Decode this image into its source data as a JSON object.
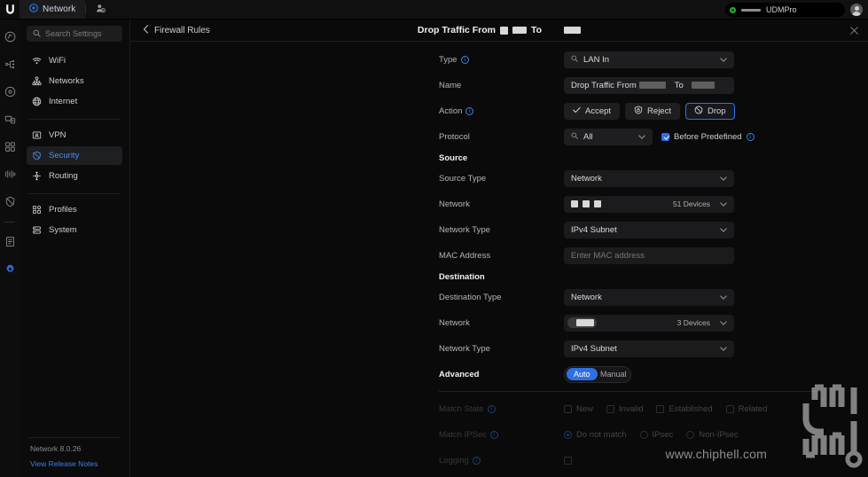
{
  "topbar": {
    "brand_icon": "ubiquiti-u-logo",
    "tabs": [
      {
        "label": "Network",
        "icon": "network-circle-icon",
        "active": true
      },
      {
        "label": "",
        "icon": "admin-users-icon",
        "active": false
      }
    ],
    "device": {
      "name": "UDMPro",
      "status_color": "#27ae3e",
      "status_icon": "status-dot-online",
      "redacted": true
    },
    "avatar_icon": "user-avatar-icon"
  },
  "rail": {
    "items": [
      {
        "name": "dashboard-icon"
      },
      {
        "name": "topology-icon"
      },
      {
        "name": "unifi-devices-icon"
      },
      {
        "name": "client-devices-icon"
      },
      {
        "name": "applications-grid-icon"
      },
      {
        "name": "insights-wave-icon"
      },
      {
        "name": "security-shield-icon"
      },
      {
        "name": "logs-icon"
      },
      {
        "name": "settings-gear-icon",
        "active": true
      }
    ]
  },
  "sidebar": {
    "search": {
      "placeholder": "Search Settings",
      "value": "",
      "icon": "search-icon"
    },
    "groups": [
      {
        "items": [
          {
            "label": "WiFi",
            "icon": "wifi-icon"
          },
          {
            "label": "Networks",
            "icon": "networks-icon"
          },
          {
            "label": "Internet",
            "icon": "globe-icon"
          }
        ]
      },
      {
        "items": [
          {
            "label": "VPN",
            "icon": "vpn-icon"
          },
          {
            "label": "Security",
            "icon": "shield-icon",
            "active": true
          },
          {
            "label": "Routing",
            "icon": "routing-icon"
          }
        ]
      },
      {
        "items": [
          {
            "label": "Profiles",
            "icon": "profiles-icon"
          },
          {
            "label": "System",
            "icon": "system-icon"
          }
        ]
      }
    ],
    "version": "Network 8.0.26",
    "release_notes": "View Release Notes"
  },
  "panel": {
    "back_label": "Firewall Rules",
    "back_icon": "chevron-left-icon",
    "close_icon": "close-icon",
    "title_parts": {
      "prefix": "Drop Traffic From",
      "middle": "To"
    }
  },
  "form": {
    "type": {
      "label": "Type",
      "value": "LAN In",
      "icon": "search-icon",
      "has_info": true
    },
    "name": {
      "label": "Name",
      "value_prefix": "Drop Traffic From",
      "value_middle": "To"
    },
    "action": {
      "label": "Action",
      "has_info": true,
      "options": [
        {
          "label": "Accept",
          "icon": "check-icon",
          "selected": false
        },
        {
          "label": "Reject",
          "icon": "reject-shield-icon",
          "selected": false
        },
        {
          "label": "Drop",
          "icon": "block-circle-icon",
          "selected": true
        }
      ]
    },
    "protocol": {
      "label": "Protocol",
      "value": "All",
      "icon": "search-icon",
      "before_predefined": {
        "label": "Before Predefined",
        "checked": true,
        "has_info": true
      }
    },
    "source": {
      "heading": "Source",
      "source_type": {
        "label": "Source Type",
        "value": "Network"
      },
      "network": {
        "label": "Network",
        "devices_count": "51 Devices",
        "redacted": true
      },
      "network_type": {
        "label": "Network Type",
        "value": "IPv4 Subnet"
      },
      "mac_address": {
        "label": "MAC Address",
        "placeholder": "Enter MAC address",
        "value": ""
      }
    },
    "destination": {
      "heading": "Destination",
      "destination_type": {
        "label": "Destination Type",
        "value": "Network"
      },
      "network": {
        "label": "Network",
        "devices_count": "3 Devices",
        "redacted": true
      },
      "network_type": {
        "label": "Network Type",
        "value": "IPv4 Subnet"
      }
    },
    "advanced": {
      "label": "Advanced",
      "options": [
        {
          "label": "Auto",
          "selected": true
        },
        {
          "label": "Manual",
          "selected": false
        }
      ]
    },
    "match_state": {
      "label": "Match State",
      "has_info": true,
      "options": [
        {
          "label": "New",
          "checked": false
        },
        {
          "label": "Invalid",
          "checked": false
        },
        {
          "label": "Established",
          "checked": false
        },
        {
          "label": "Related",
          "checked": false
        }
      ]
    },
    "match_ipsec": {
      "label": "Match IPSec",
      "has_info": true,
      "options": [
        {
          "label": "Do not match",
          "selected": true
        },
        {
          "label": "IPsec",
          "selected": false
        },
        {
          "label": "Non-IPsec",
          "selected": false
        }
      ]
    },
    "logging": {
      "label": "Logging",
      "has_info": true,
      "checked": false
    }
  },
  "watermark": {
    "text": "www.chiphell.com",
    "logo": "chiphell-logo"
  },
  "colors": {
    "accent": "#2f6fe4",
    "link": "#3f7fe8",
    "online": "#27ae3e",
    "bg": "#0a0a0a",
    "field_bg": "#1e1e20"
  }
}
